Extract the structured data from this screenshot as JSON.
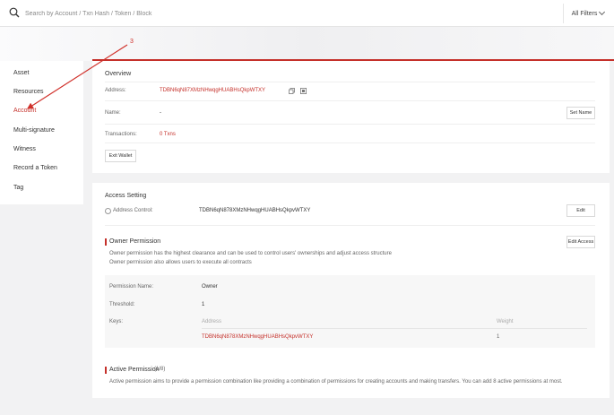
{
  "search": {
    "placeholder": "Search by Account / Txn Hash / Token / Block"
  },
  "filters": {
    "label": "All Filters"
  },
  "sidebar": {
    "items": [
      {
        "label": "Asset"
      },
      {
        "label": "Resources"
      },
      {
        "label": "Account"
      },
      {
        "label": "Multi-signature"
      },
      {
        "label": "Witness"
      },
      {
        "label": "Record a Token"
      },
      {
        "label": "Tag"
      }
    ],
    "active": "Account"
  },
  "overview": {
    "title": "Overview",
    "address_label": "Address:",
    "address": "TDBN6qN87XMzNHwqgHUABHsQkpWTXY",
    "name_label": "Name:",
    "name_value": "-",
    "set_name": "Set Name",
    "transactions_label": "Transactions:",
    "transactions_value": "0 Txns",
    "exit_wallet": "Exit Wallet"
  },
  "access": {
    "title": "Access Setting",
    "address_control_label": "Address Control:",
    "address_control_value": "TDBN6qN878XMzNHwqgHUABHsQkpvWTXY",
    "edit": "Edit",
    "owner_title": "Owner Permission",
    "edit_access": "Edit Access",
    "owner_desc_1": "Owner permission has the highest clearance and can be used to control users' ownerships and adjust access structure",
    "owner_desc_2": "Owner permission also allows users to execute all contracts",
    "permission_name_label": "Permission Name:",
    "permission_name_value": "Owner",
    "threshold_label": "Threshold:",
    "threshold_value": "1",
    "keys_label": "Keys:",
    "keys_address_header": "Address",
    "keys_weight_header": "Weight",
    "key_address": "TDBN6qN878XMzNHwqgHUABHsQkpvWTXY",
    "key_weight": "1",
    "active_title": "Active Permission",
    "active_count": "(1/8)",
    "active_desc": "Active permission aims to provide a permission combination like providing a combination of permissions for creating accounts and making transfers. You can add 8 active permissions at most."
  },
  "annotation": {
    "label": "3",
    "color": "#d0302a"
  }
}
